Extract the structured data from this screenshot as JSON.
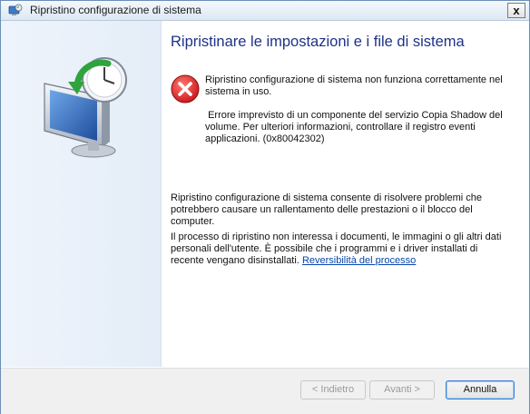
{
  "window": {
    "title": "Ripristino configurazione di sistema",
    "close_label": "x"
  },
  "content": {
    "heading": "Ripristinare le impostazioni e i file di sistema",
    "error_line1": "Ripristino configurazione di sistema non funziona correttamente nel sistema in uso.",
    "error_line2": " Errore imprevisto di un componente del servizio Copia Shadow del volume. Per ulteriori informazioni, controllare il registro eventi applicazioni. (0x80042302)",
    "info_paragraph1": "Ripristino configurazione di sistema consente di risolvere problemi che potrebbero causare un rallentamento delle prestazioni o il blocco del computer.",
    "info_paragraph2": "Il processo di ripristino non interessa i documenti, le immagini o gli altri dati personali dell'utente. È possibile che i programmi e i driver installati di recente vengano disinstallati. ",
    "link_label": "Reversibilità del processo"
  },
  "buttons": {
    "back": "< Indietro",
    "next": "Avanti >",
    "cancel": "Annulla"
  },
  "icons": {
    "title": "system-restore-icon",
    "hero": "monitor-clock-restore-icon",
    "error": "error-icon"
  },
  "colors": {
    "heading": "#1e3287",
    "link": "#0645ad",
    "error_red": "#d21f1f"
  }
}
